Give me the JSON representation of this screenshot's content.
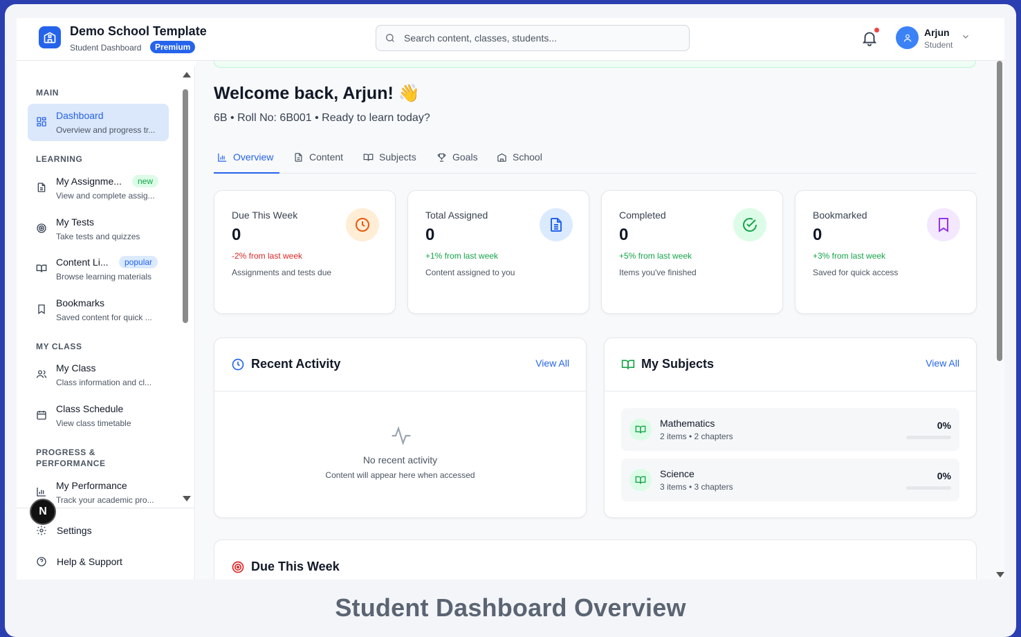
{
  "header": {
    "app_title": "Demo School Template",
    "app_subtitle": "Student Dashboard",
    "plan_badge": "Premium",
    "search_placeholder": "Search content, classes, students...",
    "user_name": "Arjun",
    "user_role": "Student",
    "notification_unread": true
  },
  "sidebar": {
    "sections": [
      "MAIN",
      "LEARNING",
      "MY CLASS",
      "PROGRESS &",
      "PERFORMANCE"
    ],
    "items": [
      {
        "title": "Dashboard",
        "desc": "Overview and progress tr...",
        "icon": "grid-icon",
        "active": true
      },
      {
        "title": "My Assignme...",
        "desc": "View and complete assig...",
        "icon": "document-icon",
        "badge": "new"
      },
      {
        "title": "My Tests",
        "desc": "Take tests and quizzes",
        "icon": "target-icon"
      },
      {
        "title": "Content Li...",
        "desc": "Browse learning materials",
        "icon": "book-open-icon",
        "badge": "popular"
      },
      {
        "title": "Bookmarks",
        "desc": "Saved content for quick ...",
        "icon": "bookmark-icon"
      },
      {
        "title": "My Class",
        "desc": "Class information and cl...",
        "icon": "users-icon"
      },
      {
        "title": "Class Schedule",
        "desc": "View class timetable",
        "icon": "calendar-icon"
      },
      {
        "title": "My Performance",
        "desc": "Track your academic pro...",
        "icon": "bar-chart-icon"
      }
    ],
    "bottom": {
      "settings": "Settings",
      "help": "Help & Support"
    },
    "floating_badge": "N"
  },
  "main": {
    "welcome": "Welcome back, Arjun! 👋",
    "subtitle": "6B • Roll No: 6B001 • Ready to learn today?",
    "tabs": [
      "Overview",
      "Content",
      "Subjects",
      "Goals",
      "School"
    ],
    "active_tab": "Overview",
    "stats": [
      {
        "label": "Due This Week",
        "value": "0",
        "change": "-2% from last week",
        "note": "Assignments and tests due",
        "icon": "clock-icon",
        "color": "#ea580c",
        "bg": "#ffedd5",
        "change_color": "#dc2626"
      },
      {
        "label": "Total Assigned",
        "value": "0",
        "change": "+1% from last week",
        "note": "Content assigned to you",
        "icon": "file-text-icon",
        "color": "#2563eb",
        "bg": "#dbeafe",
        "change_color": "#16a34a"
      },
      {
        "label": "Completed",
        "value": "0",
        "change": "+5% from last week",
        "note": "Items you've finished",
        "icon": "check-circle-icon",
        "color": "#16a34a",
        "bg": "#dcfce7",
        "change_color": "#16a34a"
      },
      {
        "label": "Bookmarked",
        "value": "0",
        "change": "+3% from last week",
        "note": "Saved for quick access",
        "icon": "bookmark-icon",
        "color": "#9333ea",
        "bg": "#f3e8ff",
        "change_color": "#16a34a"
      }
    ],
    "recent_activity": {
      "title": "Recent Activity",
      "view_all": "View All",
      "empty_title": "No recent activity",
      "empty_sub": "Content will appear here when accessed"
    },
    "my_subjects": {
      "title": "My Subjects",
      "view_all": "View All",
      "subjects": [
        {
          "name": "Mathematics",
          "meta": "2 items • 2 chapters",
          "progress": "0%",
          "progress_value": 0
        },
        {
          "name": "Science",
          "meta": "3 items • 3 chapters",
          "progress": "0%",
          "progress_value": 0
        }
      ]
    },
    "due_this_week": {
      "title": "Due This Week"
    }
  },
  "caption": "Student Dashboard Overview"
}
